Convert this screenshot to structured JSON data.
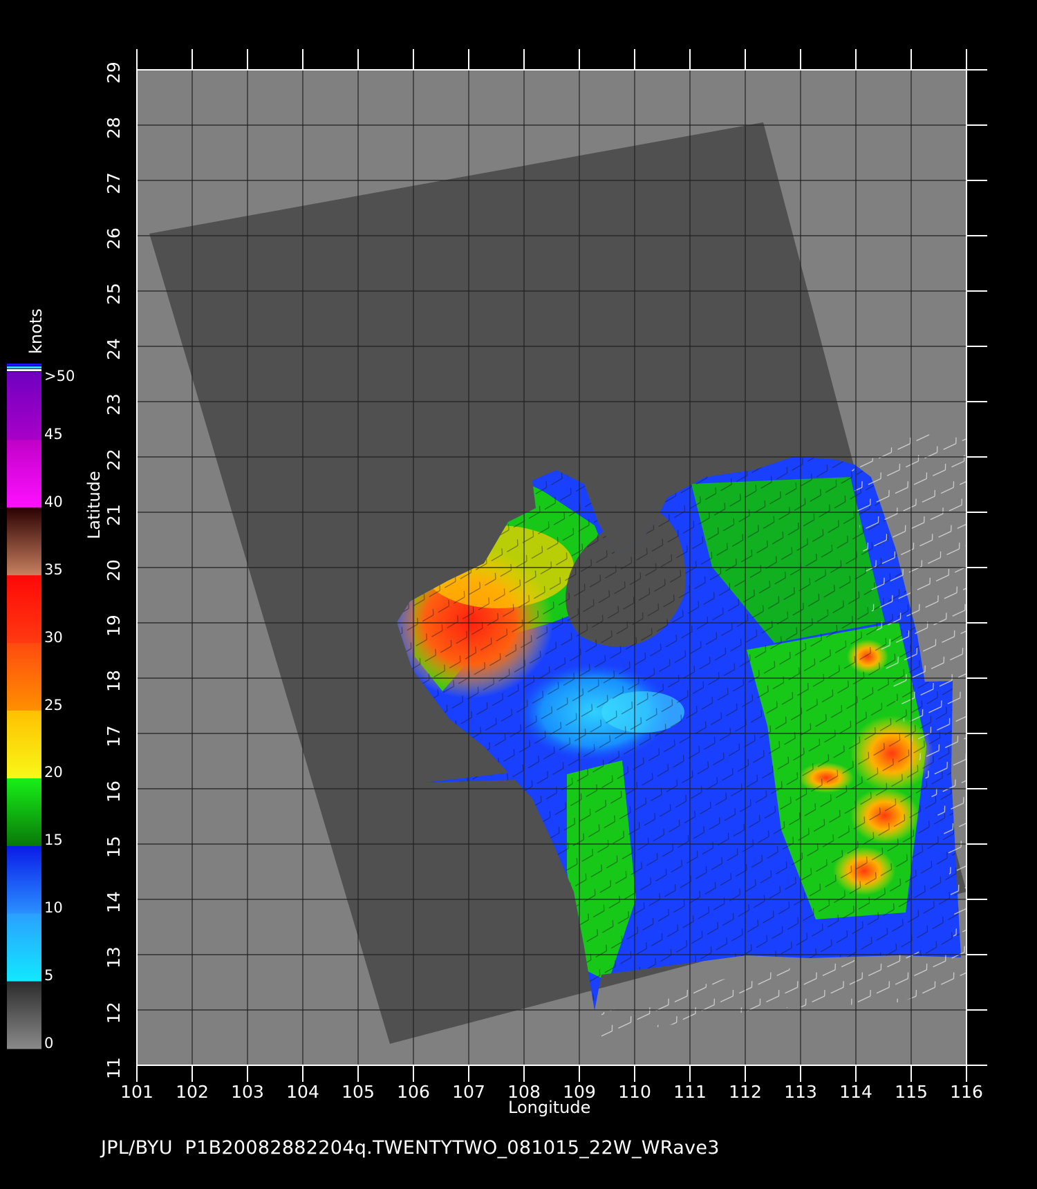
{
  "map": {
    "lon_ticks": [
      "101",
      "102",
      "103",
      "104",
      "105",
      "106",
      "107",
      "108",
      "109",
      "110",
      "111",
      "112",
      "113",
      "114",
      "115",
      "116"
    ],
    "lat_ticks": [
      "11",
      "12",
      "13",
      "14",
      "15",
      "16",
      "17",
      "18",
      "19",
      "20",
      "21",
      "22",
      "23",
      "24",
      "25",
      "26",
      "27",
      "28",
      "29"
    ],
    "lon_range": [
      101,
      116
    ],
    "lat_range": [
      11,
      29
    ],
    "grid": true,
    "xlabel": "Longitude",
    "ylabel": "Latitude",
    "caption": "JPL/BYU  P1B20082882204q.TWENTYTWO_081015_22W_WRave3"
  },
  "colorbar": {
    "units": "knots",
    "labels": [
      "0",
      "5",
      "10",
      "15",
      "20",
      "25",
      "30",
      "35",
      "40",
      "45",
      ">50"
    ],
    "bands": [
      {
        "from": 0,
        "to": 5,
        "colors": [
          "#8a8a8a",
          "#2b2b2b"
        ]
      },
      {
        "from": 5,
        "to": 10,
        "colors": [
          "#12e8ff",
          "#2aa0ff"
        ]
      },
      {
        "from": 10,
        "to": 15,
        "colors": [
          "#2a90ff",
          "#0a1ae8"
        ]
      },
      {
        "from": 15,
        "to": 20,
        "colors": [
          "#087808",
          "#18f018"
        ]
      },
      {
        "from": 20,
        "to": 25,
        "colors": [
          "#f8f818",
          "#ffc000"
        ]
      },
      {
        "from": 25,
        "to": 30,
        "colors": [
          "#ff9000",
          "#ff4a10"
        ]
      },
      {
        "from": 30,
        "to": 35,
        "colors": [
          "#ff3a10",
          "#ff0808"
        ]
      },
      {
        "from": 35,
        "to": 40,
        "colors": [
          "#c88060",
          "#2a0000"
        ]
      },
      {
        "from": 40,
        "to": 45,
        "colors": [
          "#ff10ff",
          "#c000c8"
        ]
      },
      {
        "from": 45,
        "to": 50,
        "colors": [
          "#a800c8",
          "#7000c0"
        ]
      }
    ]
  },
  "colors": {
    "background": "#000000",
    "map_fill": "#808080",
    "swath_no_data": "#505050",
    "grid": "#202020",
    "axis": "#ffffff"
  }
}
